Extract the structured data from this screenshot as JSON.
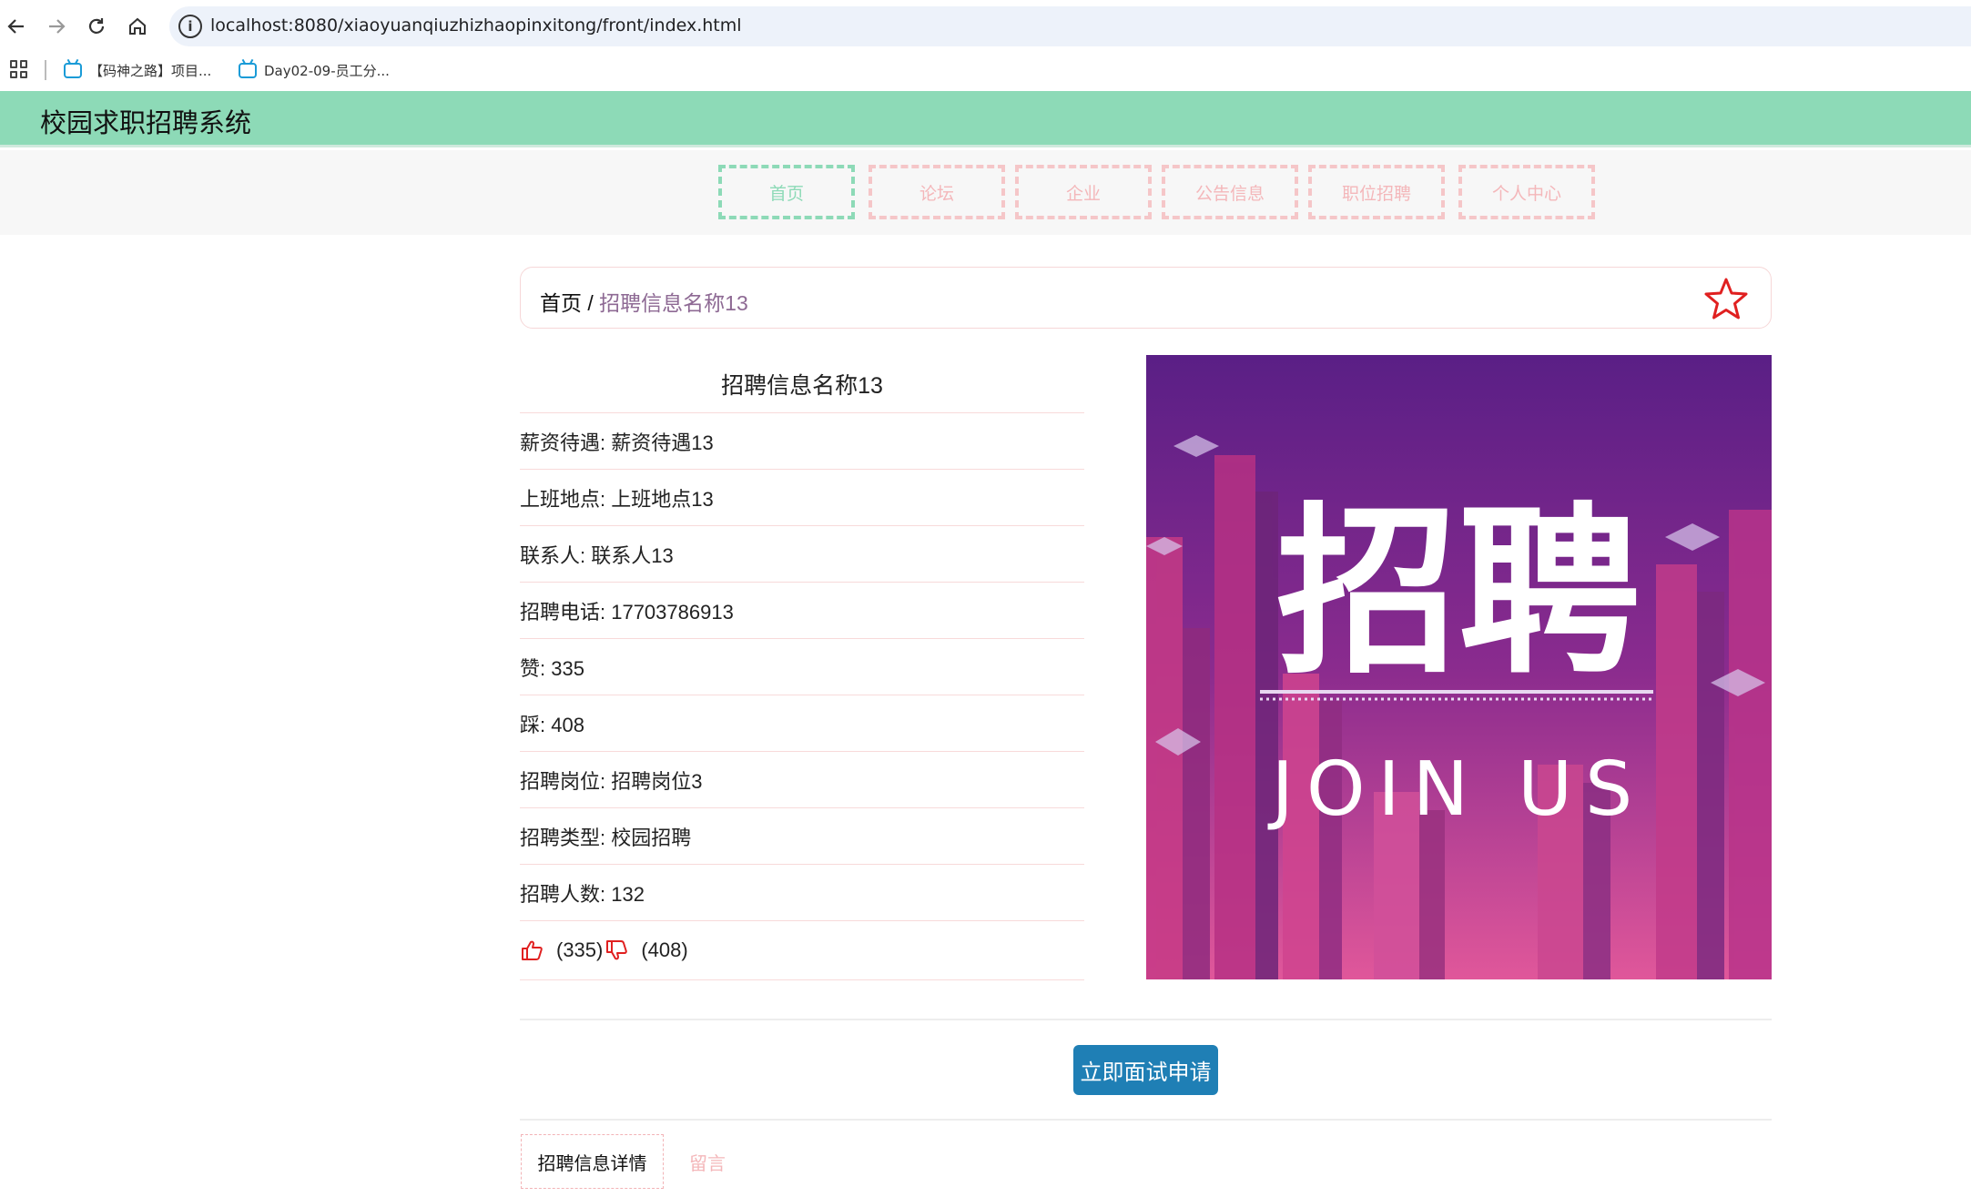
{
  "browser": {
    "url": "localhost:8080/xiaoyuanqiuzhizhaopinxitong/front/index.html",
    "bookmarks": [
      "【码神之路】项目...",
      "Day02-09-员工分..."
    ]
  },
  "site": {
    "title": "校园求职招聘系统"
  },
  "nav": {
    "items": [
      {
        "label": "首页"
      },
      {
        "label": "论坛"
      },
      {
        "label": "企业"
      },
      {
        "label": "公告信息"
      },
      {
        "label": "职位招聘"
      },
      {
        "label": "个人中心"
      }
    ],
    "active_index": 0
  },
  "breadcrumb": {
    "home": "首页",
    "separator": " / ",
    "current": "招聘信息名称13"
  },
  "detail": {
    "title": "招聘信息名称13",
    "fields": [
      {
        "label": "薪资待遇",
        "value": "薪资待遇13",
        "text": "薪资待遇: 薪资待遇13"
      },
      {
        "label": "上班地点",
        "value": "上班地点13",
        "text": "上班地点: 上班地点13"
      },
      {
        "label": "联系人",
        "value": "联系人13",
        "text": "联系人: 联系人13"
      },
      {
        "label": "招聘电话",
        "value": "17703786913",
        "text": "招聘电话: 17703786913"
      },
      {
        "label": "赞",
        "value": "335",
        "text": "赞: 335"
      },
      {
        "label": "踩",
        "value": "408",
        "text": "踩: 408"
      },
      {
        "label": "招聘岗位",
        "value": "招聘岗位3",
        "text": "招聘岗位: 招聘岗位3"
      },
      {
        "label": "招聘类型",
        "value": "校园招聘",
        "text": "招聘类型: 校园招聘"
      },
      {
        "label": "招聘人数",
        "value": "132",
        "text": "招聘人数: 132"
      }
    ],
    "likes": "(335)",
    "dislikes": "(408)"
  },
  "poster": {
    "headline": "招聘",
    "subline": "JOIN US"
  },
  "actions": {
    "apply_label": "立即面试申请"
  },
  "tabs": [
    {
      "label": "招聘信息详情",
      "active": true
    },
    {
      "label": "留言",
      "active": false
    }
  ],
  "colors": {
    "header_bg": "#8ddab7",
    "nav_active": "#8ddab7",
    "nav_inactive": "#f4b7ba",
    "button_bg": "#1f7fb5",
    "star": "#e02020",
    "thumb": "#e02020"
  },
  "icons": {
    "back": "arrow-left-icon",
    "forward": "arrow-right-icon",
    "reload": "reload-icon",
    "home": "home-icon",
    "info": "info-icon",
    "apps": "apps-grid-icon",
    "favorite": "star-outline-icon",
    "like": "thumbs-up-icon",
    "dislike": "thumbs-down-icon"
  }
}
